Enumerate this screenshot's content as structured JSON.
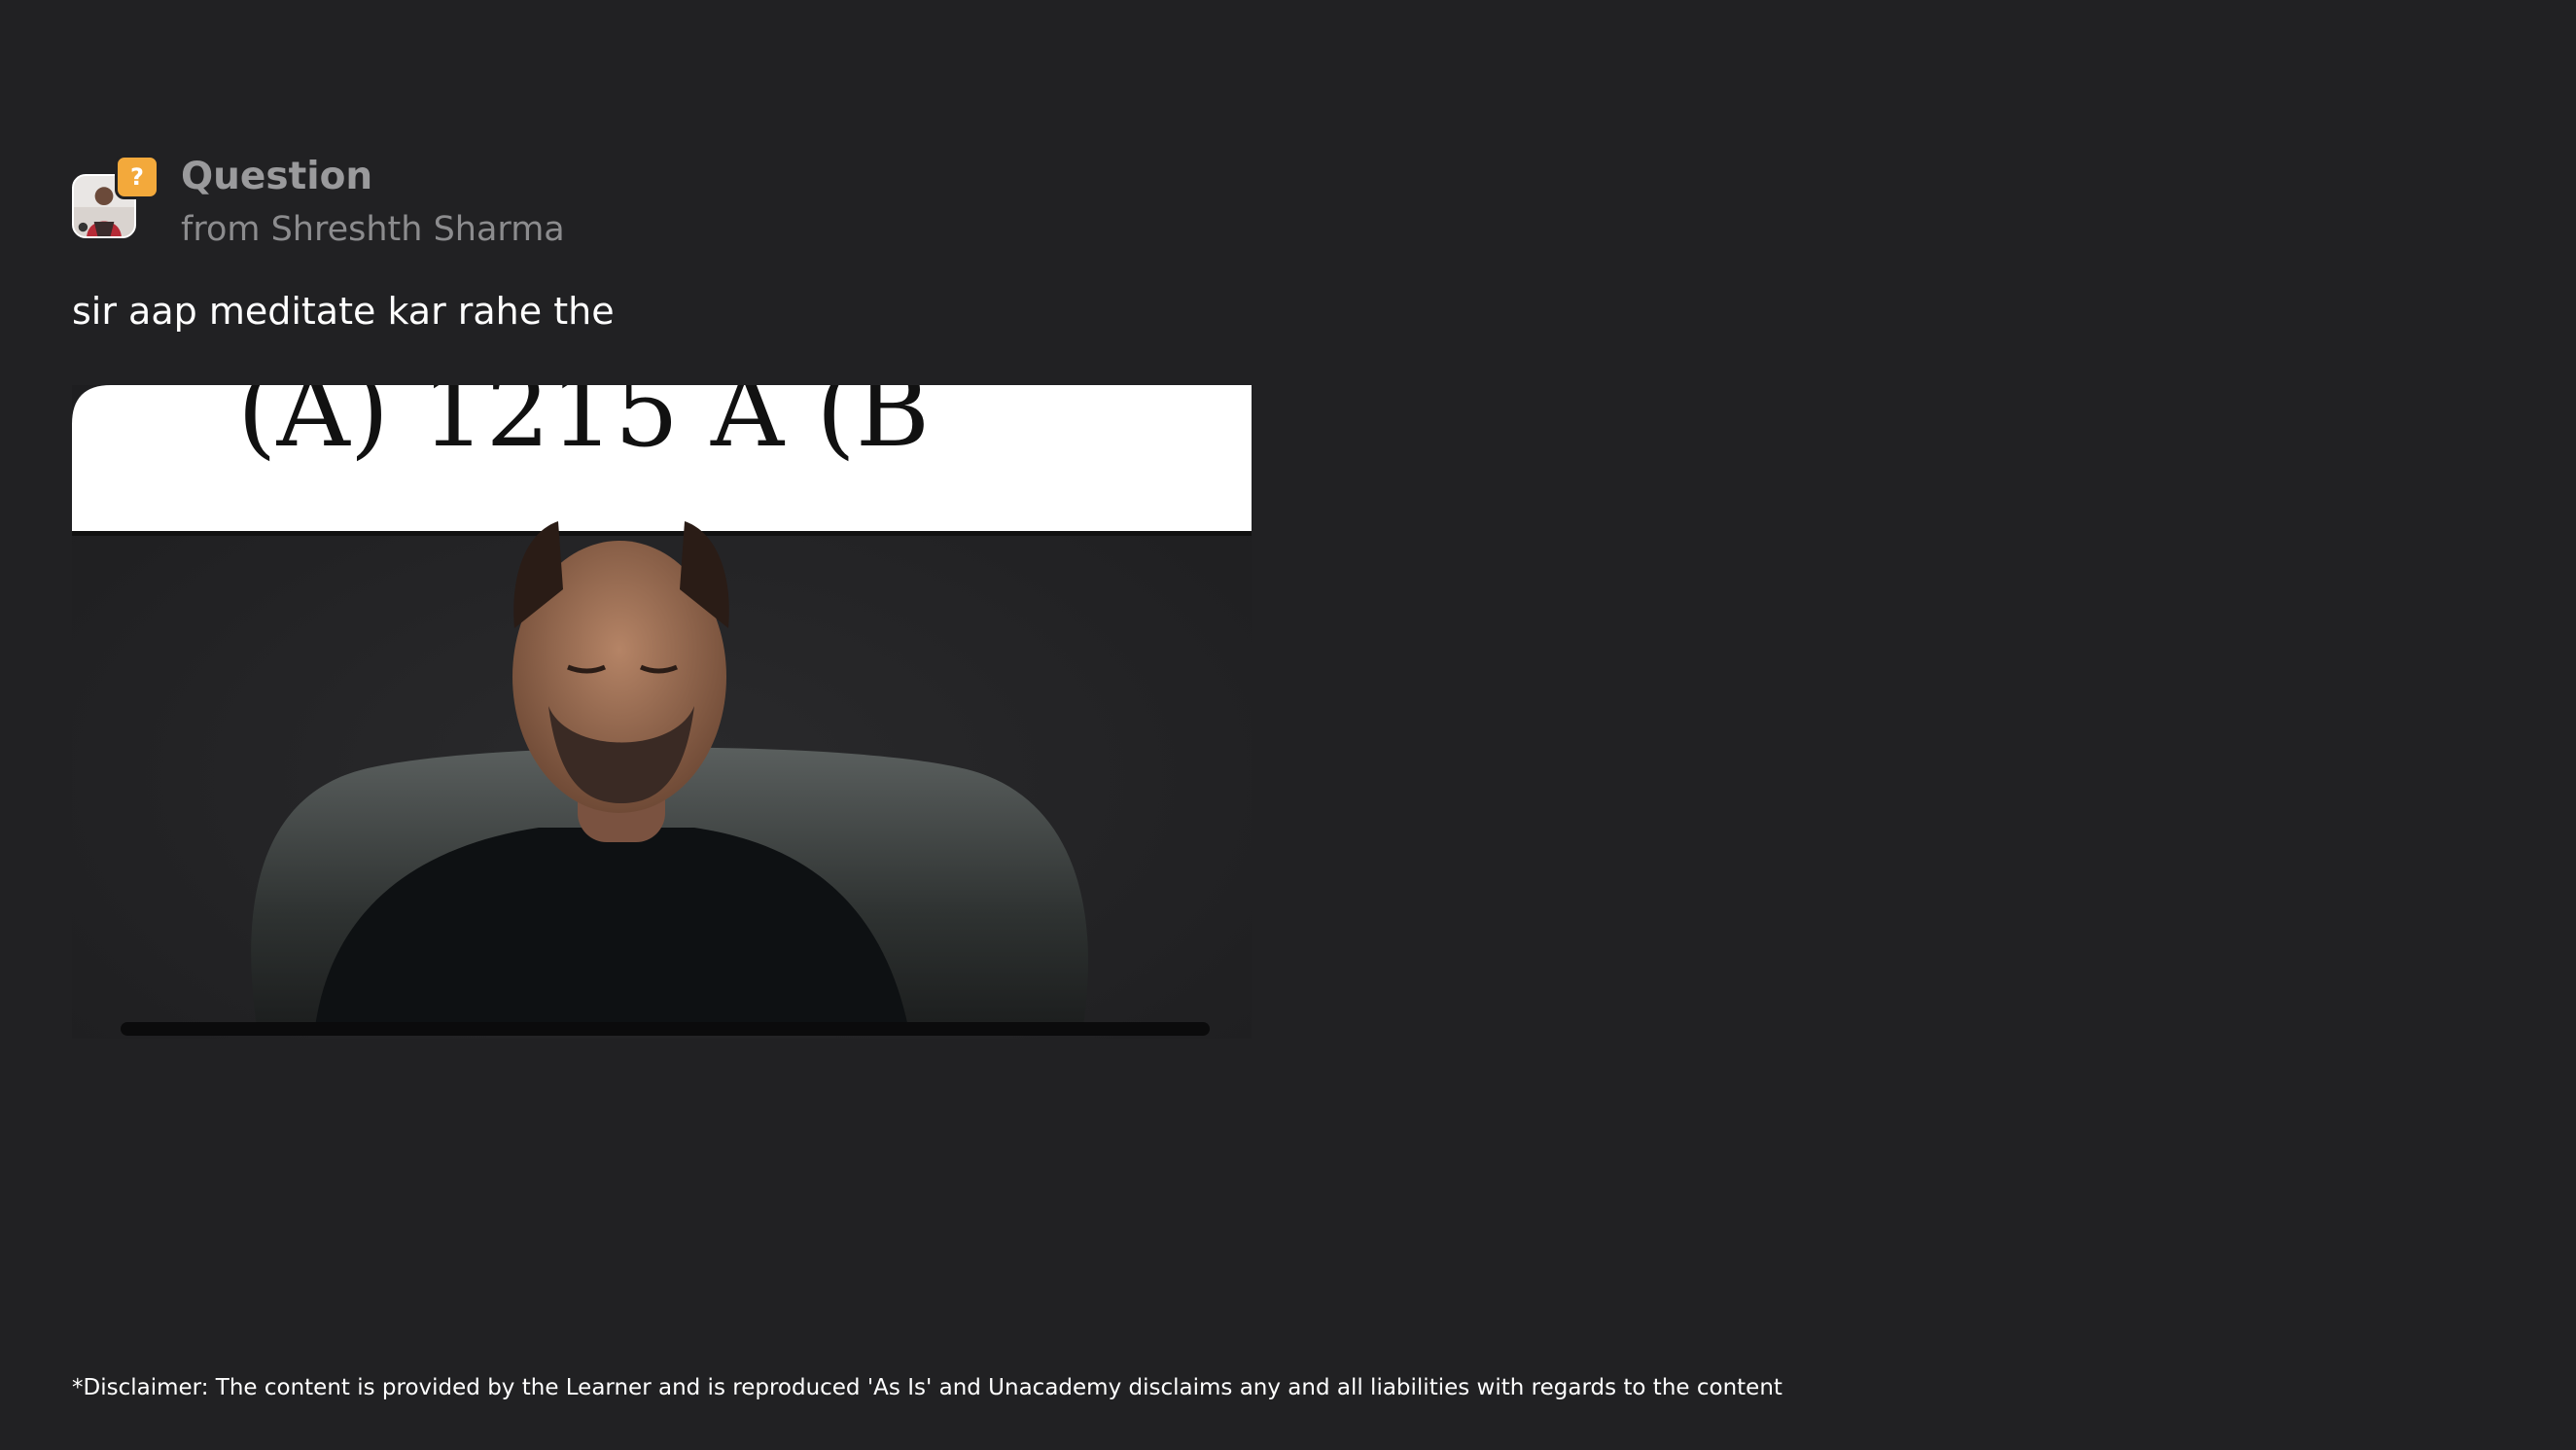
{
  "card": {
    "title": "Question",
    "from": "from Shreshth Sharma",
    "badge_glyph": "?",
    "badge_color": "#f3a93b",
    "avatar_icon": "user-avatar"
  },
  "question": {
    "text": "sir aap meditate kar rahe the"
  },
  "attachment": {
    "board_text": "(A)  1215 A  (B",
    "description_icon": "video-frame-image"
  },
  "footer": {
    "disclaimer": "*Disclaimer: The content is provided by the Learner and is reproduced 'As Is' and Unacademy disclaims any and all liabilities with regards to the content"
  },
  "colors": {
    "background": "#212123",
    "title": "#9a9a9c",
    "text": "#ffffff",
    "accent": "#f3a93b"
  }
}
